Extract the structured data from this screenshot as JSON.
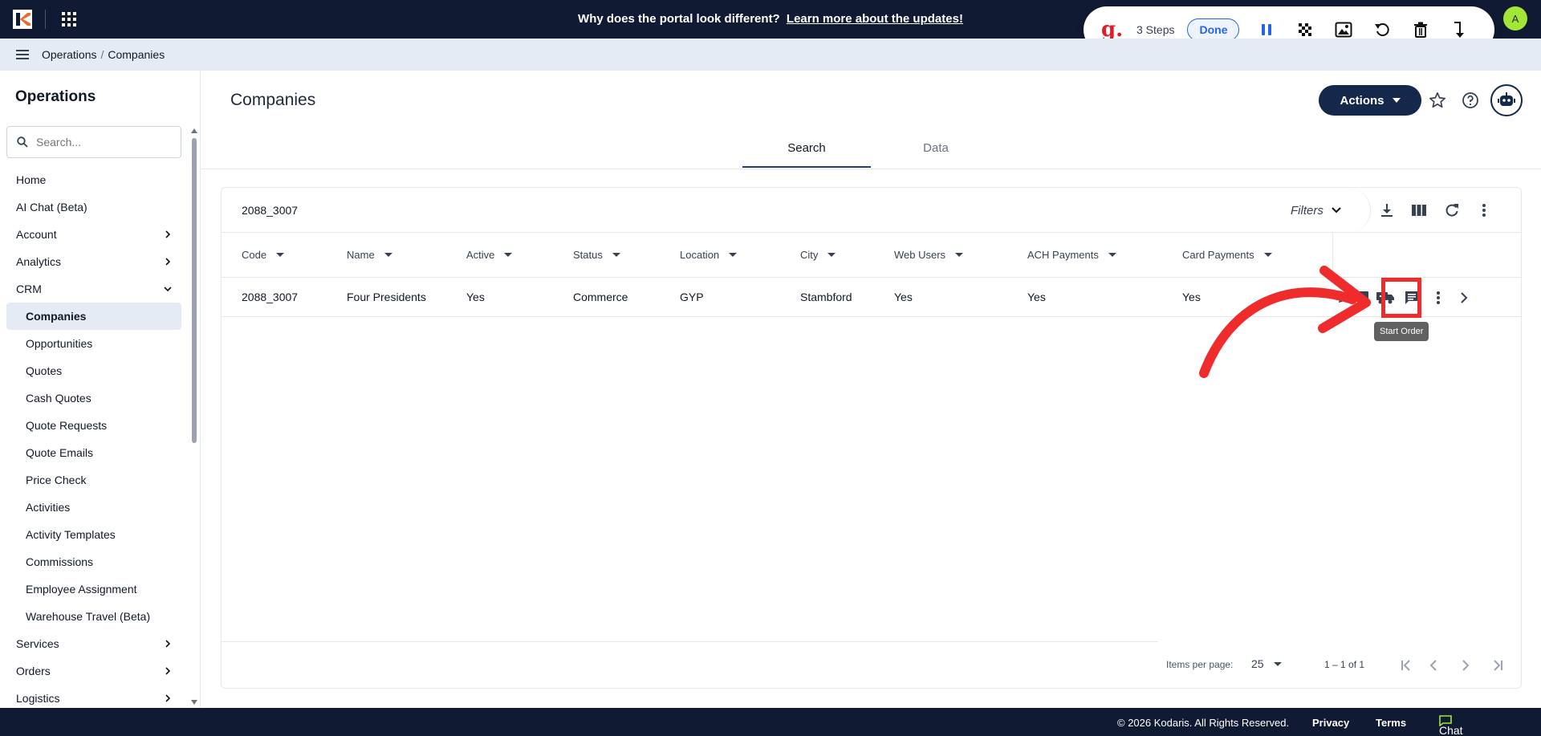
{
  "announcement": {
    "question": "Why does the portal look different?",
    "link": "Learn more about the updates!"
  },
  "recorder": {
    "logo": "g.",
    "steps": "3 Steps",
    "done": "Done"
  },
  "user": {
    "initial": "A"
  },
  "breadcrumb": {
    "section": "Operations",
    "page": "Companies"
  },
  "sidebar": {
    "title": "Operations",
    "search_placeholder": "Search...",
    "items": [
      {
        "label": "Home"
      },
      {
        "label": "AI Chat (Beta)"
      },
      {
        "label": "Account"
      },
      {
        "label": "Analytics"
      },
      {
        "label": "CRM"
      },
      {
        "label": "Companies"
      },
      {
        "label": "Opportunities"
      },
      {
        "label": "Quotes"
      },
      {
        "label": "Cash Quotes"
      },
      {
        "label": "Quote Requests"
      },
      {
        "label": "Quote Emails"
      },
      {
        "label": "Price Check"
      },
      {
        "label": "Activities"
      },
      {
        "label": "Activity Templates"
      },
      {
        "label": "Commissions"
      },
      {
        "label": "Employee Assignment"
      },
      {
        "label": "Warehouse Travel (Beta)"
      },
      {
        "label": "Services"
      },
      {
        "label": "Orders"
      },
      {
        "label": "Logistics"
      }
    ]
  },
  "main": {
    "title": "Companies",
    "actions_label": "Actions",
    "tabs": [
      {
        "label": "Search"
      },
      {
        "label": "Data"
      }
    ],
    "search_value": "2088_3007",
    "filters_label": "Filters",
    "columns": [
      "Code",
      "Name",
      "Active",
      "Status",
      "Location",
      "City",
      "Web Users",
      "ACH Payments",
      "Card Payments"
    ],
    "rows": [
      {
        "code": "2088_3007",
        "name": "Four Presidents",
        "active": "Yes",
        "status": "Commerce",
        "location": "GYP",
        "city": "Stambford",
        "web_users": "Yes",
        "ach": "Yes",
        "card": "Yes"
      }
    ],
    "tooltip": "Start Order",
    "items_per_page_label": "Items per page:",
    "items_per_page": "25",
    "range": "1 – 1 of 1"
  },
  "footer": {
    "copyright": "© 2026 Kodaris. All Rights Reserved.",
    "privacy": "Privacy",
    "terms": "Terms",
    "chat": "Chat with us"
  },
  "colors": {
    "navy": "#101b33",
    "accent": "#13284a",
    "highlight": "#ef2b2b",
    "lime": "#a3e635"
  }
}
